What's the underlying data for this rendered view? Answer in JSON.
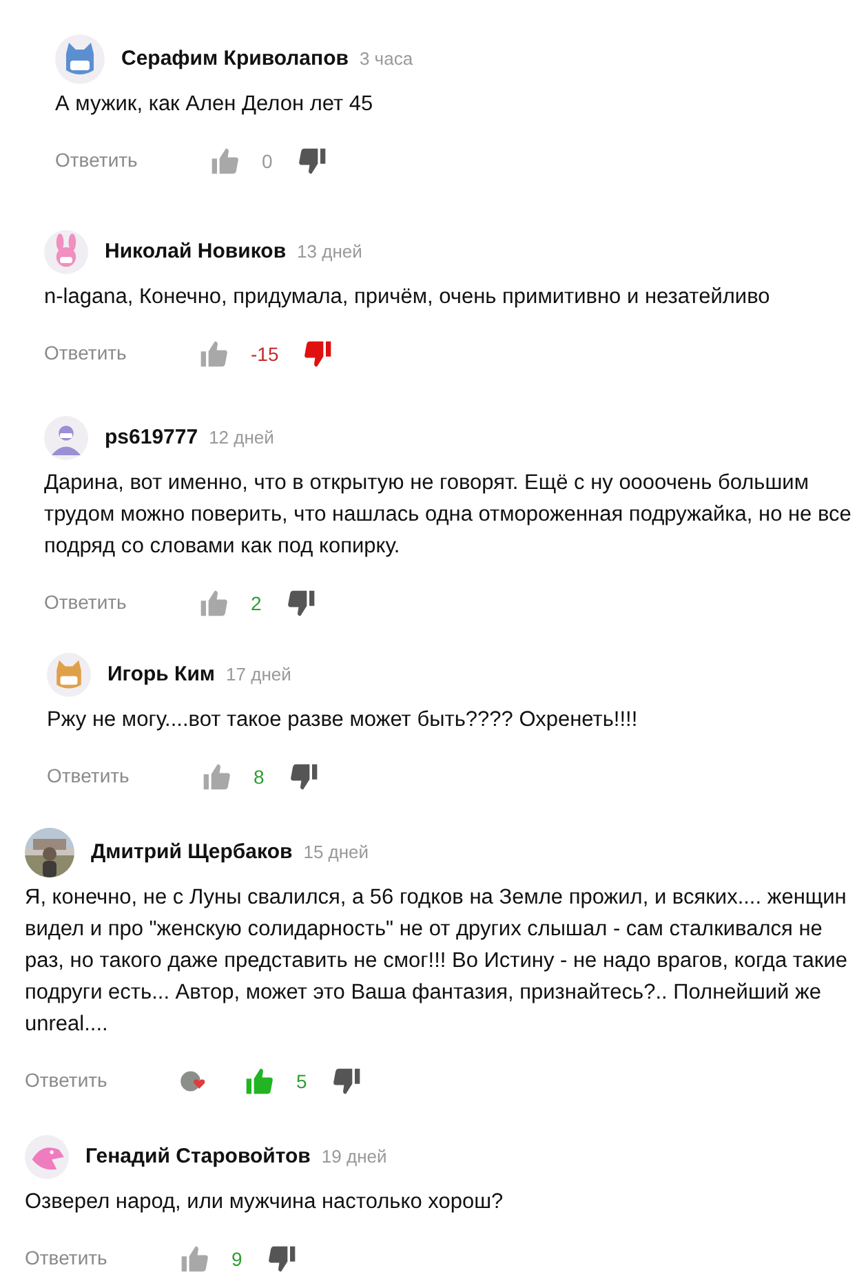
{
  "comments": [
    {
      "author": "Серафим Криволапов",
      "time": "3 часа",
      "avatar": {
        "kind": "mask",
        "color": "#5b8fd0"
      },
      "text": "А мужик, как Ален Делон лет 45",
      "reply": "Ответить",
      "score": {
        "text": "0",
        "color": "#999999"
      },
      "liked": false,
      "disliked": false
    },
    {
      "author": "Николай Новиков",
      "time": "13 дней",
      "avatar": {
        "kind": "bunny",
        "color": "#f08fc0"
      },
      "text": "n-lagana, Конечно, придумала, причём, очень примитивно и незатейливо",
      "reply": "Ответить",
      "score": {
        "text": "-15",
        "color": "#c62828"
      },
      "liked": false,
      "disliked": true
    },
    {
      "author": "ps619777",
      "time": "12 дней",
      "avatar": {
        "kind": "person",
        "color": "#9b8fd6"
      },
      "text": "Дарина, вот именно, что в открытую не говорят. Ещё с ну оооочень большим трудом можно поверить, что нашлась одна отмороженная подружайка, но не все подряд со словами как под копирку.",
      "reply": "Ответить",
      "score": {
        "text": "2",
        "color": "#2e9e2e"
      },
      "liked": false,
      "disliked": false
    },
    {
      "author": "Игорь Ким",
      "time": "17 дней",
      "avatar": {
        "kind": "mask",
        "color": "#e0a04a"
      },
      "text": "Ржу не могу....вот такое разве может быть???? Охренеть!!!!",
      "reply": "Ответить",
      "score": {
        "text": "8",
        "color": "#2e9e2e"
      },
      "liked": false,
      "disliked": false
    },
    {
      "author": "Дмитрий Щербаков",
      "time": "15 дней",
      "text": "Я, конечно, не с Луны свалился, а 56 годков на Земле прожил, и всяких.... женщин видел и про \"женскую солидарность\" не от других слышал - сам сталкивался не раз, но такого даже представить не смог!!! Во Истину - не надо врагов, когда такие подруги есть... Автор, может это Ваша фантазия, признайтесь?.. Полнейший же unreal....",
      "reply": "Ответить",
      "author_heart": true,
      "score": {
        "text": "5",
        "color": "#2e9e2e"
      },
      "liked": true,
      "disliked": false
    },
    {
      "author": "Генадий Старовойтов",
      "time": "19 дней",
      "avatar": {
        "kind": "bird",
        "color": "#f07cc0"
      },
      "text": "Озверел народ, или мужчина настолько хорош?",
      "reply": "Ответить",
      "score": {
        "text": "9",
        "color": "#2e9e2e"
      },
      "liked": false,
      "disliked": false
    }
  ]
}
